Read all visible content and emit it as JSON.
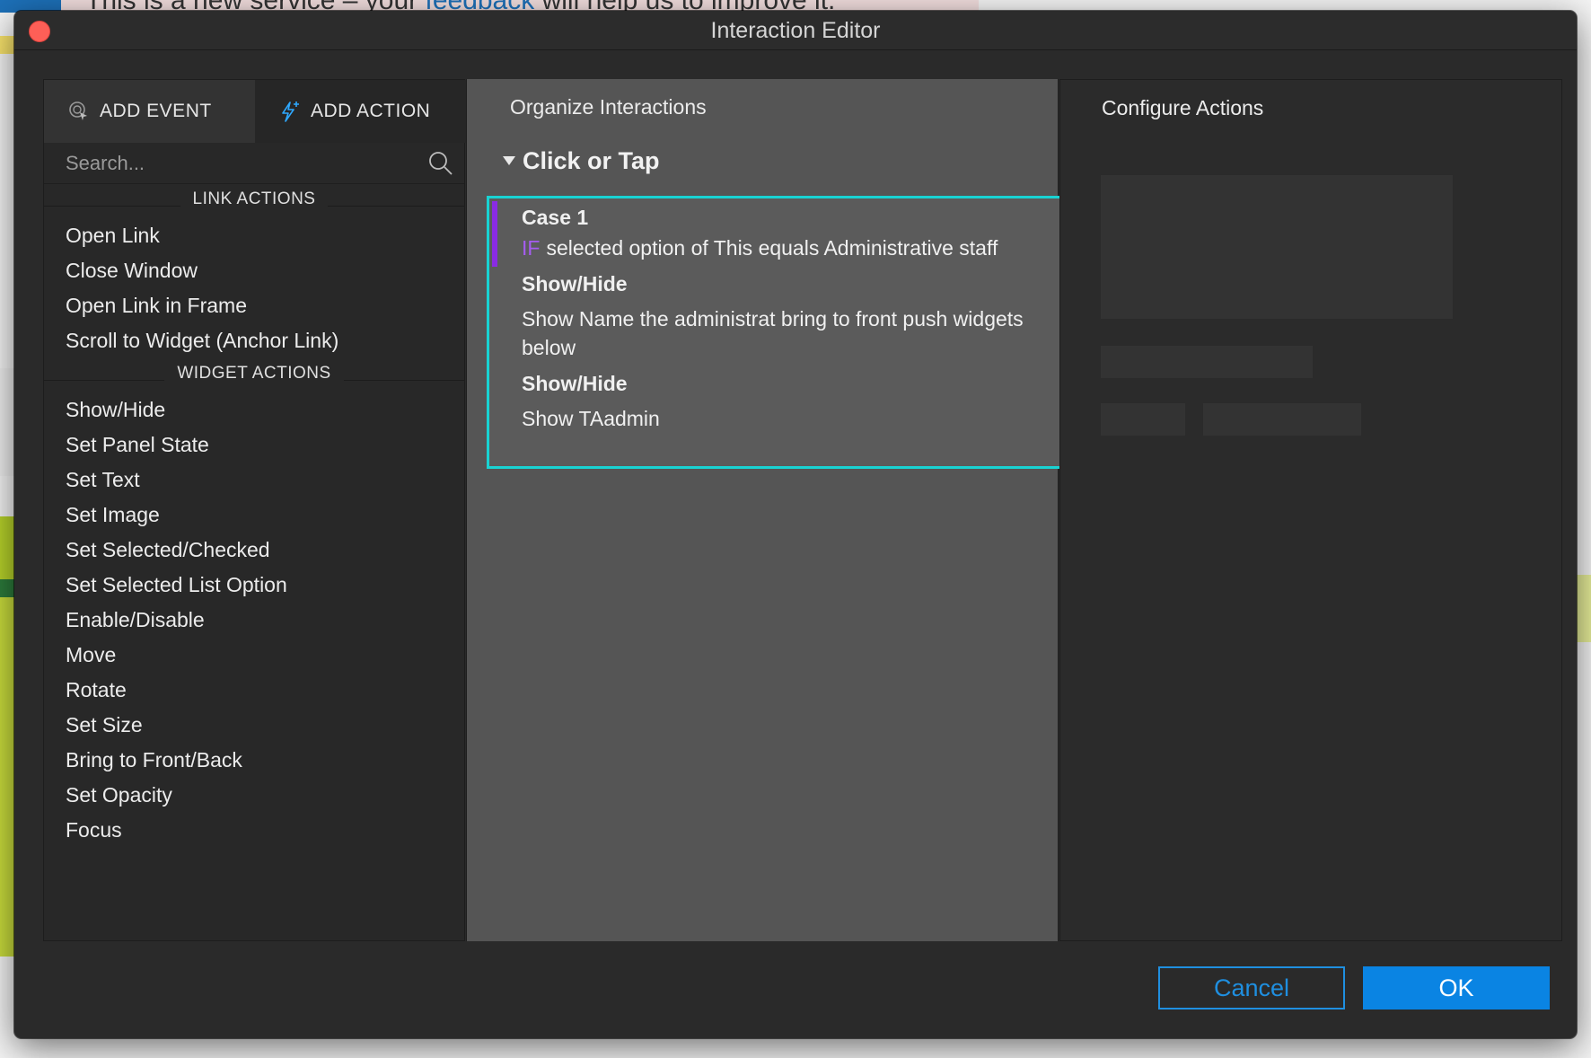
{
  "background": {
    "banner_text_prefix": "This is a new service – your ",
    "banner_link": "feedback",
    "banner_text_suffix": " will help us to improve it."
  },
  "window": {
    "title": "Interaction Editor"
  },
  "tabs": [
    {
      "label": "ADD EVENT",
      "icon": "cursor-click-icon"
    },
    {
      "label": "ADD ACTION",
      "icon": "lightning-plus-icon",
      "active": true
    }
  ],
  "search": {
    "placeholder": "Search..."
  },
  "link_actions": {
    "header": "LINK ACTIONS",
    "items": [
      "Open Link",
      "Close Window",
      "Open Link in Frame",
      "Scroll to Widget (Anchor Link)"
    ]
  },
  "widget_actions": {
    "header": "WIDGET ACTIONS",
    "items": [
      "Show/Hide",
      "Set Panel State",
      "Set Text",
      "Set Image",
      "Set Selected/Checked",
      "Set Selected List Option",
      "Enable/Disable",
      "Move",
      "Rotate",
      "Set Size",
      "Bring to Front/Back",
      "Set Opacity",
      "Focus"
    ]
  },
  "organize": {
    "title": "Organize Interactions",
    "event": "Click or Tap",
    "case": {
      "title": "Case 1",
      "if_keyword": "IF",
      "condition": "selected option of This equals Administrative staff",
      "actions": [
        {
          "title": "Show/Hide",
          "description": "Show Name the administrat  bring to front push widgets below"
        },
        {
          "title": "Show/Hide",
          "description": "Show TAadmin"
        }
      ]
    }
  },
  "configure": {
    "title": "Configure Actions"
  },
  "footer": {
    "cancel_label": "Cancel",
    "ok_label": "OK"
  },
  "colors": {
    "accent_blue": "#0a84e3",
    "selection_cyan": "#19d3d3",
    "if_purple": "#a55cf0",
    "case_bar": "#8a2be2"
  }
}
